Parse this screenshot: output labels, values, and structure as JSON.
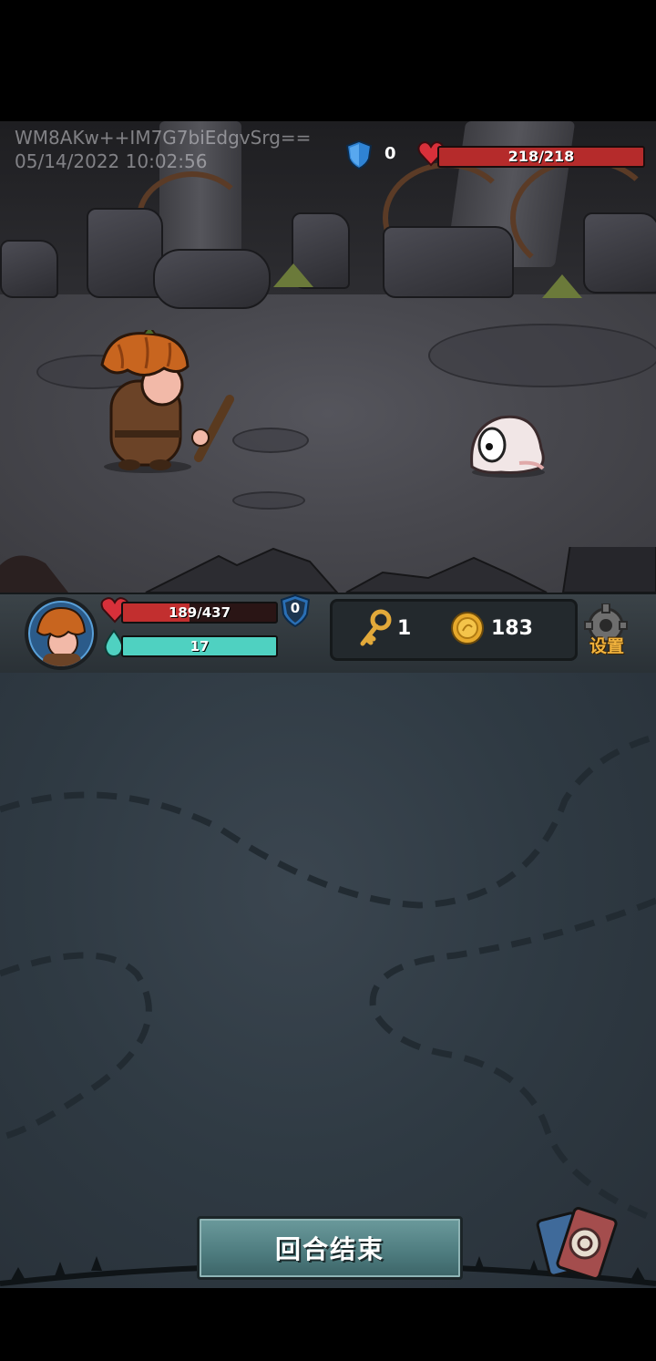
{
  "watermark": {
    "line1": "WM8AKw++IM7G7biEdgvSrg==",
    "line2": "05/14/2022 10:02:56"
  },
  "enemy": {
    "shield": "0",
    "hp_text": "218/218",
    "hp_fraction": 1.0,
    "icons": {
      "shield": "blue-shield-icon",
      "heart": "red-heart-icon"
    }
  },
  "player": {
    "hp_text": "189/437",
    "hp_fraction": 0.432,
    "energy_text": "17",
    "energy_fraction": 1.0,
    "shield": "0"
  },
  "resources": {
    "keys": "1",
    "coins": "183"
  },
  "settings": {
    "label": "设置"
  },
  "end_turn": {
    "label": "回合结束"
  },
  "colors": {
    "hp": "#c22f2f",
    "energy": "#4fd1c1",
    "settings_text": "#f2b33d",
    "end_turn": "#4d7b7e"
  }
}
